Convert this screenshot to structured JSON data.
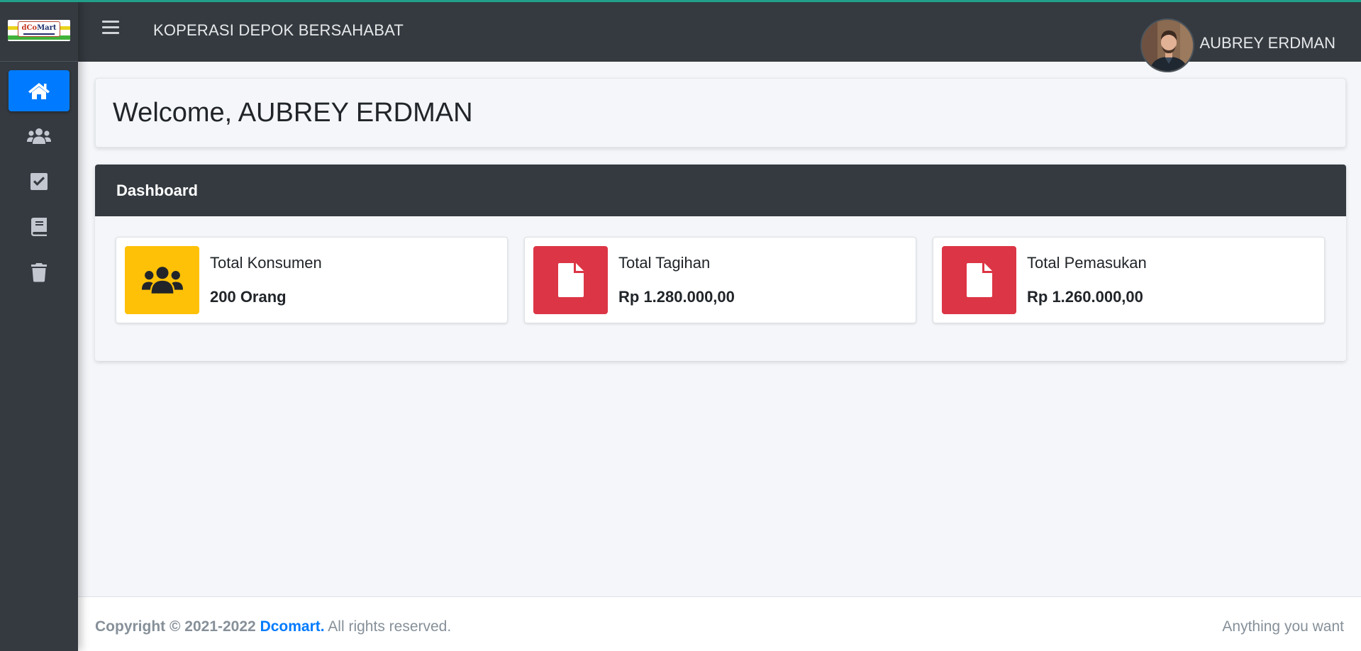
{
  "app": {
    "title": "KOPERASI DEPOK BERSAHABAT",
    "logo_text_prefix": "d",
    "logo_text_accent": "Co",
    "logo_text_suffix": "Mart"
  },
  "user": {
    "name": "AUBREY ERDMAN"
  },
  "sidebar": {
    "items": [
      {
        "icon": "home-icon",
        "active": true
      },
      {
        "icon": "users-icon",
        "active": false
      },
      {
        "icon": "check-square-icon",
        "active": false
      },
      {
        "icon": "book-icon",
        "active": false
      },
      {
        "icon": "trash-icon",
        "active": false
      }
    ]
  },
  "welcome": {
    "text": "Welcome, AUBREY ERDMAN"
  },
  "dashboard": {
    "title": "Dashboard",
    "boxes": [
      {
        "label": "Total Konsumen",
        "value": "200 Orang",
        "icon": "users-icon",
        "color": "#ffc107"
      },
      {
        "label": "Total Tagihan",
        "value": "Rp 1.280.000,00",
        "icon": "file-icon",
        "color": "#dc3545"
      },
      {
        "label": "Total Pemasukan",
        "value": "Rp 1.260.000,00",
        "icon": "file-icon",
        "color": "#dc3545"
      }
    ]
  },
  "footer": {
    "copyright_prefix": "Copyright © 2021-2022",
    "brand_link": "Dcomart.",
    "rights": "All rights reserved.",
    "tagline": "Anything you want"
  },
  "colors": {
    "primary": "#007bff",
    "dark": "#343a40",
    "warning": "#ffc107",
    "danger": "#dc3545",
    "background": "#f4f6f9"
  }
}
